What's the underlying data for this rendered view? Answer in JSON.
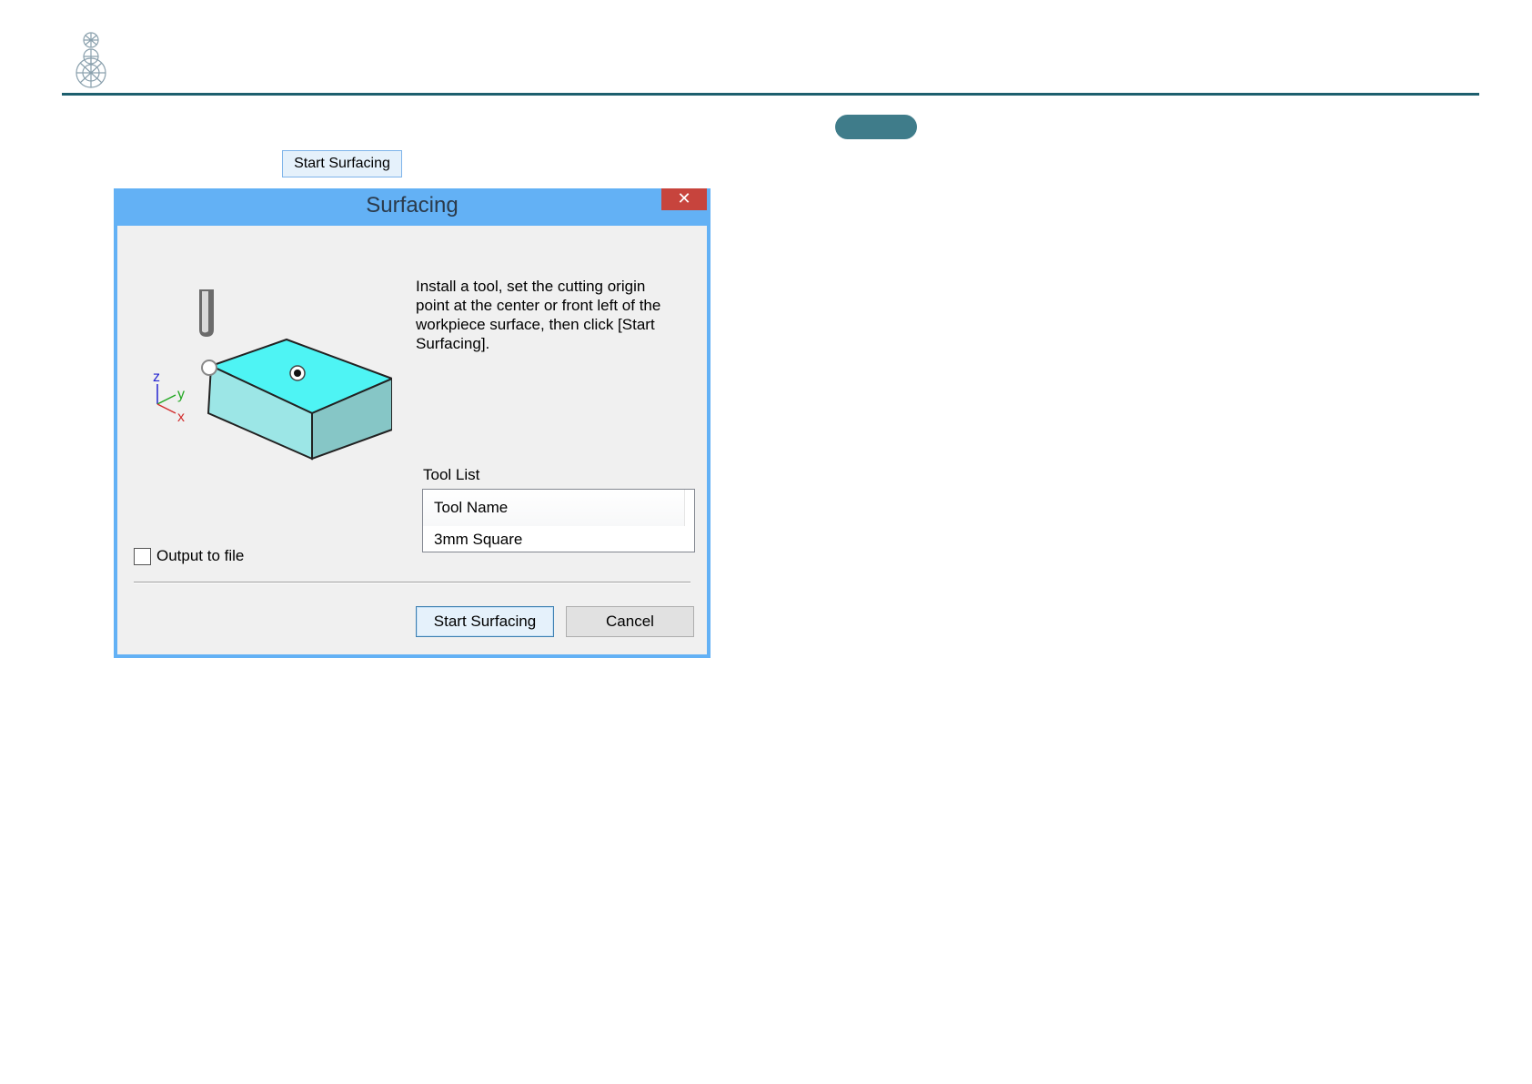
{
  "header": {
    "logo_icon": "faceted-figure-logo",
    "rule_color": "#1d5f6e",
    "pill_color": "#3f7c8a"
  },
  "top_button_label": "Start Surfacing",
  "dialog": {
    "title": "Surfacing",
    "close_glyph": "✕",
    "description": "Install a tool, set the cutting origin point at the center or front left of the workpiece surface, then click [Start Surfacing].",
    "illustration": {
      "axes": {
        "z": "z",
        "y": "y",
        "x": "x"
      },
      "block_top_color": "#4ef4f4",
      "block_front_color": "#9ce6e6",
      "block_side_color": "#86c6c6"
    },
    "tool_list": {
      "label": "Tool List",
      "header": "Tool Name",
      "rows": [
        "3mm Square"
      ]
    },
    "output_to_file": {
      "label": "Output to file",
      "checked": false
    },
    "buttons": {
      "start": "Start Surfacing",
      "cancel": "Cancel"
    }
  }
}
